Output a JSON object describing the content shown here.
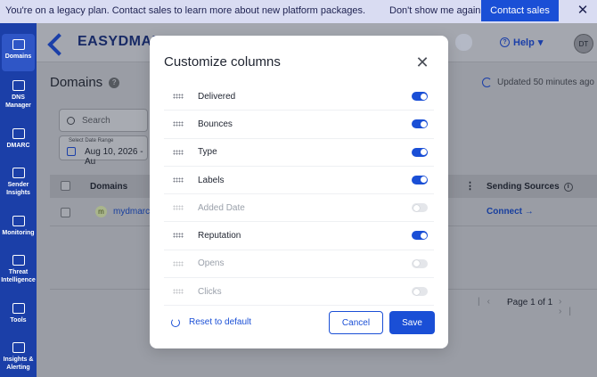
{
  "banner": {
    "text": "You're on a legacy plan. Contact sales to learn more about new platform packages.",
    "dismiss_label": "Don't show me again",
    "cta_label": "Contact sales",
    "close_icon": "close-icon"
  },
  "sidebar": {
    "items": [
      {
        "label": "Domains",
        "icon": "domains-icon",
        "active": true
      },
      {
        "label": "DNS Manager",
        "icon": "dns-icon",
        "active": false
      },
      {
        "label": "DMARC",
        "icon": "dmarc-icon",
        "active": false
      },
      {
        "label": "Sender Insights",
        "icon": "sender-insights-icon",
        "active": false
      },
      {
        "label": "Monitoring",
        "icon": "monitoring-icon",
        "active": false
      },
      {
        "label": "Threat Intelligence",
        "icon": "threat-icon",
        "active": false
      },
      {
        "label": "Tools",
        "icon": "tools-icon",
        "active": false
      },
      {
        "label": "Insights & Alerting",
        "icon": "insights-icon",
        "active": false
      }
    ]
  },
  "topbar": {
    "logo_text": "EASYDMARC",
    "help_label": "Help",
    "avatar_initials": "DT"
  },
  "page": {
    "title": "Domains",
    "updated": "Updated 50 minutes ago",
    "search_placeholder": "Search",
    "date_label": "Select Date Range",
    "date_value": "Aug 10, 2026 - Au"
  },
  "table": {
    "col_domains": "Domains",
    "col_sources": "Sending Sources",
    "rows": [
      {
        "badge": "m",
        "domain": "mydmarc.",
        "connect": "Connect →"
      }
    ],
    "pager": "Page 1 of 1"
  },
  "modal": {
    "title": "Customize columns",
    "columns": [
      {
        "label": "Delivered",
        "enabled": true
      },
      {
        "label": "Bounces",
        "enabled": true
      },
      {
        "label": "Type",
        "enabled": true
      },
      {
        "label": "Labels",
        "enabled": true
      },
      {
        "label": "Added Date",
        "enabled": false
      },
      {
        "label": "Reputation",
        "enabled": true
      },
      {
        "label": "Opens",
        "enabled": false
      },
      {
        "label": "Clicks",
        "enabled": false
      }
    ],
    "reset_label": "Reset to default",
    "cancel_label": "Cancel",
    "save_label": "Save"
  },
  "colors": {
    "accent": "#1a4fd6",
    "sidebar": "#1b3fa8",
    "banner_bg": "#d9dcf2"
  }
}
